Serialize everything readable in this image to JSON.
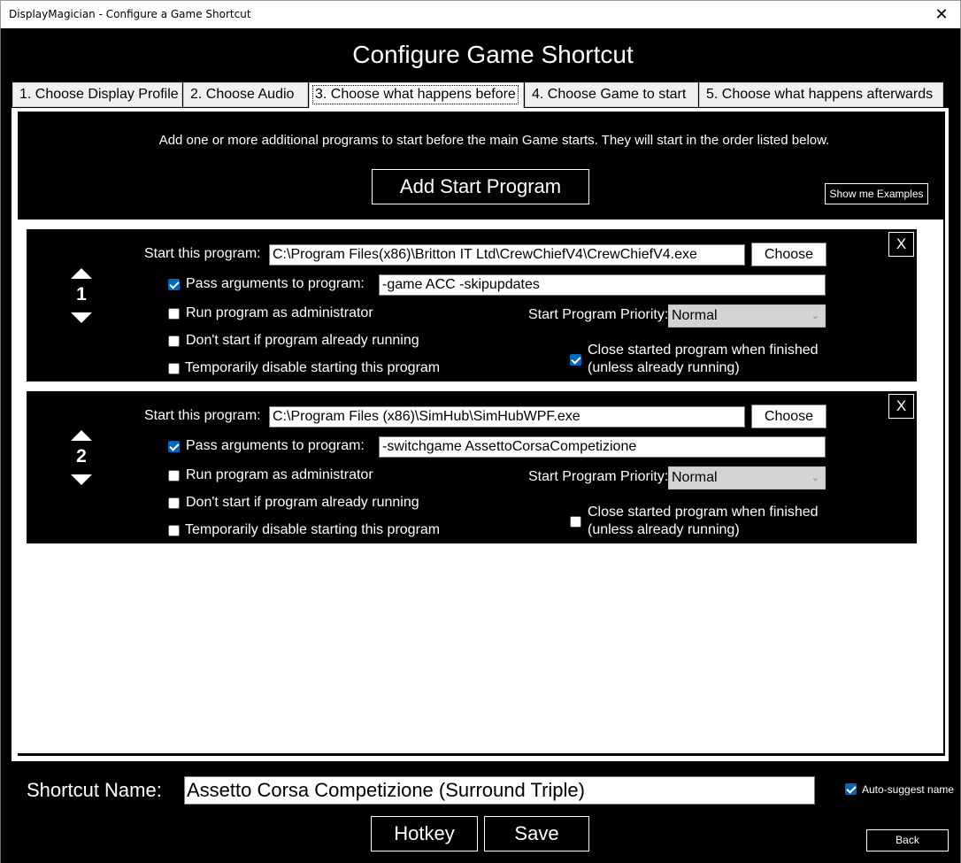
{
  "window": {
    "title": "DisplayMagician - Configure a Game Shortcut",
    "close_label": "✕"
  },
  "heading": "Configure Game Shortcut",
  "tabs": [
    {
      "label": "1. Choose Display Profile"
    },
    {
      "label": "2. Choose Audio"
    },
    {
      "label": "3. Choose what happens before"
    },
    {
      "label": "4. Choose Game to start"
    },
    {
      "label": "5. Choose what happens afterwards"
    }
  ],
  "intro_text": "Add one or more additional programs to start before the main Game starts. They will start in the order listed below.",
  "add_button_label": "Add Start Program",
  "examples_button_label": "Show me Examples",
  "programs": [
    {
      "index": "1",
      "start_label": "Start this program:",
      "path": "C:\\Program Files(x86)\\Britton IT Ltd\\CrewChiefV4\\CrewChiefV4.exe",
      "choose_label": "Choose",
      "close_label": "X",
      "pass_args_label": "Pass arguments to program:",
      "pass_args_checked": true,
      "args": "-game ACC -skipupdates",
      "run_admin_label": "Run program as administrator",
      "run_admin_checked": false,
      "dont_start_label": "Don't start if program already running",
      "dont_start_checked": false,
      "disable_label": "Temporarily disable starting this program",
      "disable_checked": false,
      "priority_label": "Start Program Priority:",
      "priority_value": "Normal",
      "close_finished_line1": "Close started program when finished",
      "close_finished_line2": "(unless already running)",
      "close_finished_checked": true
    },
    {
      "index": "2",
      "start_label": "Start this program:",
      "path": "C:\\Program Files (x86)\\SimHub\\SimHubWPF.exe",
      "choose_label": "Choose",
      "close_label": "X",
      "pass_args_label": "Pass arguments to program:",
      "pass_args_checked": true,
      "args": "-switchgame AssettoCorsaCompetizione",
      "run_admin_label": "Run program as administrator",
      "run_admin_checked": false,
      "dont_start_label": "Don't start if program already running",
      "dont_start_checked": false,
      "disable_label": "Temporarily disable starting this program",
      "disable_checked": false,
      "priority_label": "Start Program Priority:",
      "priority_value": "Normal",
      "close_finished_line1": "Close started program when finished",
      "close_finished_line2": "(unless already running)",
      "close_finished_checked": false
    }
  ],
  "shortcut": {
    "label": "Shortcut Name:",
    "value": "Assetto Corsa Competizione (Surround Triple)",
    "auto_suggest_label": "Auto-suggest name",
    "auto_suggest_checked": true
  },
  "buttons": {
    "hotkey": "Hotkey",
    "save": "Save",
    "back": "Back"
  },
  "colors": {
    "checkbox_accent": "#0067c0",
    "background": "#000000",
    "panel": "#ffffff"
  }
}
